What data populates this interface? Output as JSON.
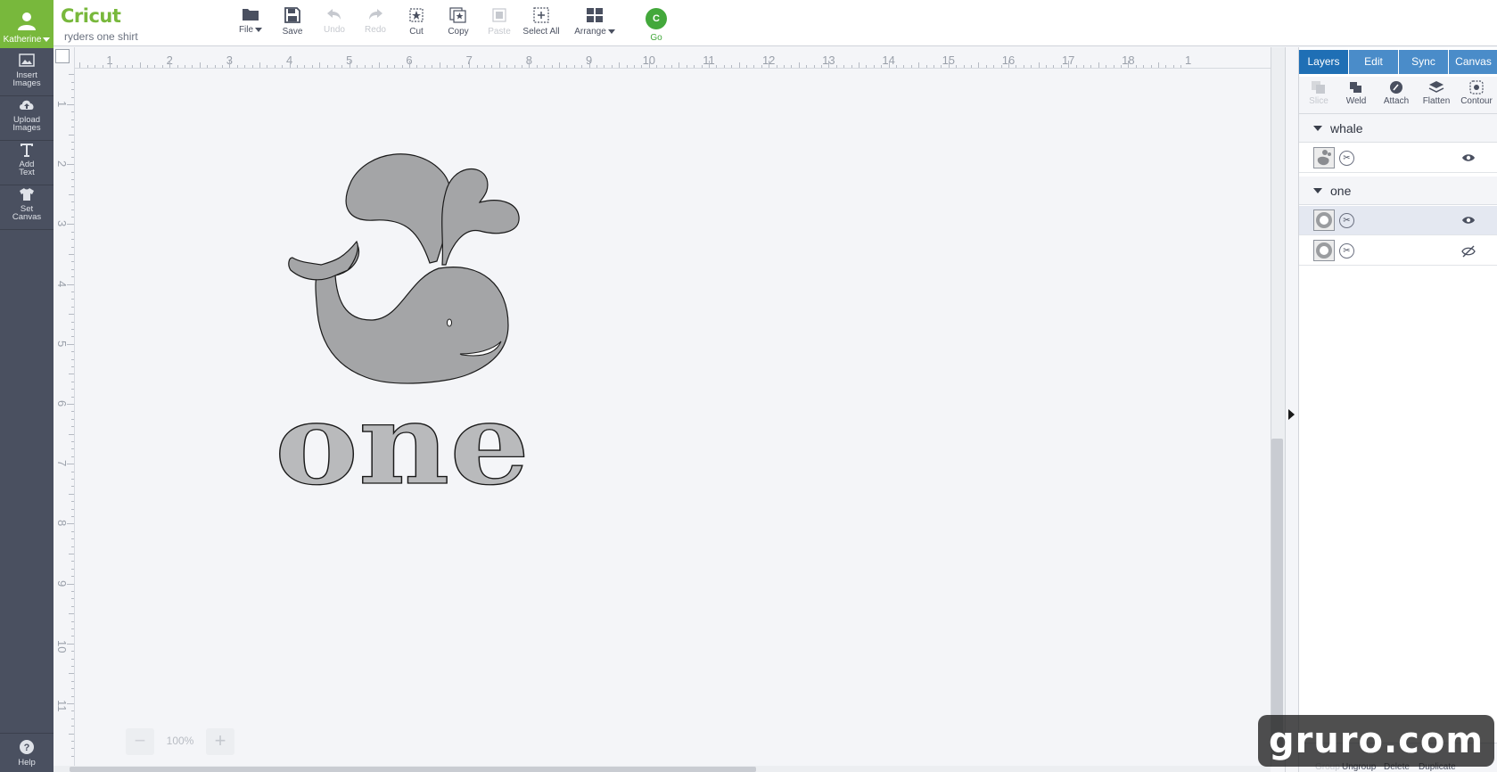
{
  "sidebar": {
    "user": "Katherine",
    "items": [
      {
        "label": "Insert\nImages",
        "icon": "image-icon"
      },
      {
        "label": "Upload\nImages",
        "icon": "upload-cloud-icon"
      },
      {
        "label": "Add\nText",
        "icon": "text-icon"
      },
      {
        "label": "Set\nCanvas",
        "icon": "tshirt-icon"
      }
    ],
    "help": "Help"
  },
  "header": {
    "logo": "Cricut",
    "project_name": "ryders one shirt"
  },
  "toolbar": {
    "file": "File",
    "save": "Save",
    "undo": "Undo",
    "redo": "Redo",
    "cut": "Cut",
    "copy": "Copy",
    "paste": "Paste",
    "select_all": "Select All",
    "arrange": "Arrange",
    "go": "Go",
    "go_glyph": "C"
  },
  "ruler": {
    "top": [
      "1",
      "2",
      "3",
      "4",
      "5",
      "6",
      "7",
      "8",
      "9",
      "10",
      "11",
      "12",
      "13",
      "14",
      "15",
      "16",
      "17",
      "18",
      "1"
    ],
    "left": [
      "1",
      "2",
      "3",
      "4",
      "5",
      "6",
      "7",
      "8",
      "9",
      "10",
      "11"
    ]
  },
  "canvas": {
    "zoom": "100%",
    "text_layer": "one",
    "shape_color": "#a4a5a7",
    "text_color": "#b9babc"
  },
  "panel": {
    "tabs": [
      "Layers",
      "Edit",
      "Sync",
      "Canvas"
    ],
    "active_tab": "Layers",
    "tools": {
      "slice": "Slice",
      "weld": "Weld",
      "attach": "Attach",
      "flatten": "Flatten",
      "contour": "Contour"
    },
    "groups": [
      {
        "name": "whale"
      },
      {
        "name": "one"
      }
    ],
    "bottom": {
      "group": "Group",
      "ungroup": "Ungroup",
      "delete": "Delete",
      "duplicate": "Duplicate"
    }
  },
  "watermark": "gruro.com",
  "colors": {
    "brand_green": "#78b83c",
    "go_green": "#43a83b",
    "tab_blue": "#4a8cc9",
    "tab_active": "#1f6fb5",
    "sidebar": "#4a5060"
  }
}
